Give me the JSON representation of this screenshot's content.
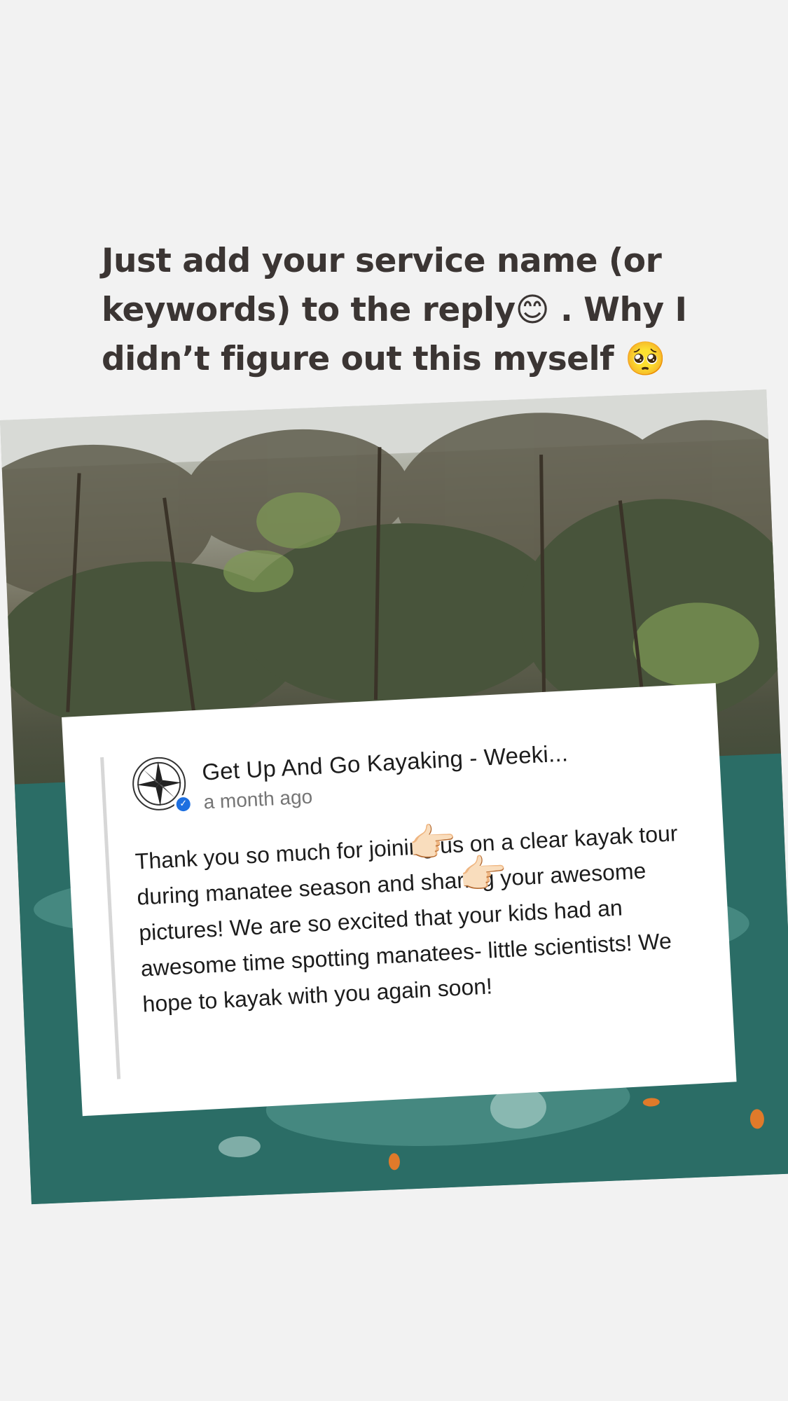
{
  "caption": {
    "text": "Just add your service name (or keywords) to the reply😊 . Why I didn’t figure out this  myself 🥺"
  },
  "review_reply": {
    "author": "Get Up And Go Kayaking - Weeki...",
    "timestamp": "a month ago",
    "message": "Thank you so much for joining us on a clear kayak tour during manatee season and sharing your awesome pictures! We are so excited that your kids had an awesome time spotting manatees- little scientists! We hope to kayak with you again soon!",
    "verified_icon": "check-badge-icon",
    "pointer_emoji": "👉🏻"
  },
  "background": {
    "scene": "river-with-trees-photo"
  }
}
